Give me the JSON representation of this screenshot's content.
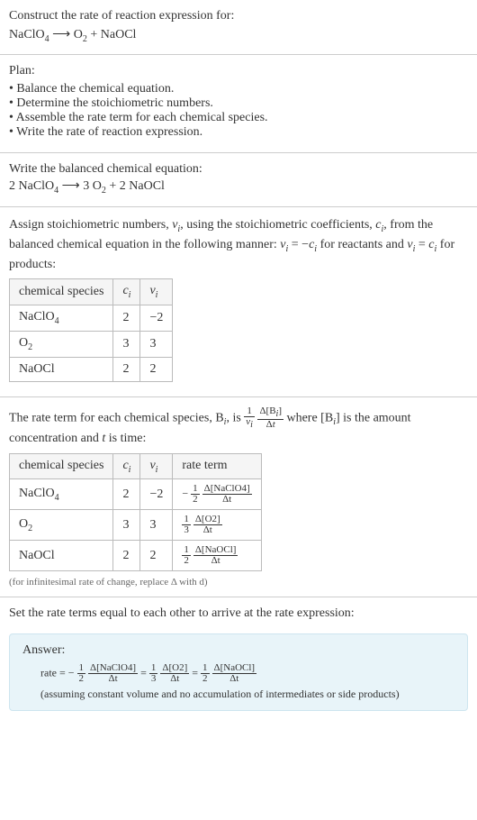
{
  "prompt": {
    "title": "Construct the rate of reaction expression for:",
    "equation_html": "NaClO<sub>4</sub> ⟶ O<sub>2</sub> + NaOCl"
  },
  "plan": {
    "heading": "Plan:",
    "items": [
      "Balance the chemical equation.",
      "Determine the stoichiometric numbers.",
      "Assemble the rate term for each chemical species.",
      "Write the rate of reaction expression."
    ]
  },
  "balanced": {
    "heading": "Write the balanced chemical equation:",
    "equation_html": "2 NaClO<sub>4</sub> ⟶ 3 O<sub>2</sub> + 2 NaOCl"
  },
  "stoich": {
    "intro_html": "Assign stoichiometric numbers, <span class=\"ital\">ν<sub>i</sub></span>, using the stoichiometric coefficients, <span class=\"ital\">c<sub>i</sub></span>, from the balanced chemical equation in the following manner: <span class=\"ital\">ν<sub>i</sub></span> = −<span class=\"ital\">c<sub>i</sub></span> for reactants and <span class=\"ital\">ν<sub>i</sub></span> = <span class=\"ital\">c<sub>i</sub></span> for products:",
    "headers": {
      "sp": "chemical species",
      "c": "c_i",
      "v": "ν_i"
    },
    "rows": [
      {
        "sp_html": "NaClO<sub>4</sub>",
        "c": "2",
        "v": "−2"
      },
      {
        "sp_html": "O<sub>2</sub>",
        "c": "3",
        "v": "3"
      },
      {
        "sp_html": "NaOCl",
        "c": "2",
        "v": "2"
      }
    ]
  },
  "rateterm": {
    "intro_pre": "The rate term for each chemical species, B",
    "intro_mid": ", is ",
    "intro_after_frac": " where [B",
    "intro_tail": "] is the amount concentration and ",
    "intro_tail2": " is time:",
    "headers": {
      "sp": "chemical species",
      "c": "c_i",
      "v": "ν_i",
      "rt": "rate term"
    },
    "rows": [
      {
        "sp_html": "NaClO<sub>4</sub>",
        "c": "2",
        "v": "−2",
        "sign": "−",
        "coef_num": "1",
        "coef_den": "2",
        "dnum": "Δ[NaClO4]"
      },
      {
        "sp_html": "O<sub>2</sub>",
        "c": "3",
        "v": "3",
        "sign": "",
        "coef_num": "1",
        "coef_den": "3",
        "dnum": "Δ[O2]"
      },
      {
        "sp_html": "NaOCl",
        "c": "2",
        "v": "2",
        "sign": "",
        "coef_num": "1",
        "coef_den": "2",
        "dnum": "Δ[NaOCl]"
      }
    ],
    "note": "(for infinitesimal rate of change, replace Δ with d)"
  },
  "final": {
    "heading": "Set the rate terms equal to each other to arrive at the rate expression:"
  },
  "answer": {
    "label": "Answer:",
    "prefix": "rate = ",
    "terms": [
      {
        "sign": "−",
        "num": "1",
        "den": "2",
        "dnum": "Δ[NaClO4]"
      },
      {
        "sign": "",
        "num": "1",
        "den": "3",
        "dnum": "Δ[O2]"
      },
      {
        "sign": "",
        "num": "1",
        "den": "2",
        "dnum": "Δ[NaOCl]"
      }
    ],
    "note": "(assuming constant volume and no accumulation of intermediates or side products)"
  },
  "dt": "Δt"
}
